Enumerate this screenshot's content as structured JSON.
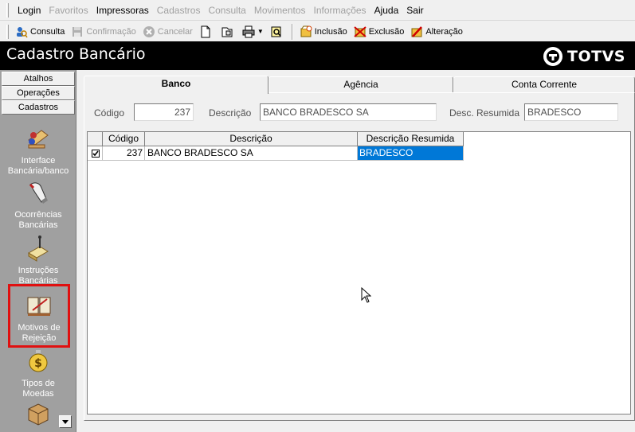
{
  "menu": {
    "items": [
      {
        "label": "Login",
        "enabled": true
      },
      {
        "label": "Favoritos",
        "enabled": false
      },
      {
        "label": "Impressoras",
        "enabled": true
      },
      {
        "label": "Cadastros",
        "enabled": false
      },
      {
        "label": "Consulta",
        "enabled": false
      },
      {
        "label": "Movimentos",
        "enabled": false
      },
      {
        "label": "Informações",
        "enabled": false
      },
      {
        "label": "Ajuda",
        "enabled": true
      },
      {
        "label": "Sair",
        "enabled": true
      }
    ]
  },
  "toolbar": {
    "consulta": "Consulta",
    "confirmacao": "Confirmação",
    "cancelar": "Cancelar",
    "inclusao": "Inclusão",
    "exclusao": "Exclusão",
    "alteracao": "Alteração"
  },
  "window": {
    "title": "Cadastro Bancário",
    "brand": "TOTVS"
  },
  "sidebar": {
    "sections": [
      "Atalhos",
      "Operações",
      "Cadastros"
    ],
    "items": [
      {
        "label_line1": "Interface",
        "label_line2": "Bancária/banco",
        "icon": "bank-interface-icon"
      },
      {
        "label_line1": "Ocorrências",
        "label_line2": "Bancárias",
        "icon": "occurrences-icon"
      },
      {
        "label_line1": "Instruções",
        "label_line2": "Bancárias",
        "icon": "instructions-icon"
      },
      {
        "label_line1": "Motivos de",
        "label_line2": "Rejeição",
        "icon": "rejection-reasons-icon",
        "selected": true
      },
      {
        "label_line1": "Tipos de",
        "label_line2": "Moedas",
        "icon": "currency-types-icon"
      }
    ]
  },
  "tabs": {
    "banco": "Banco",
    "agencia": "Agência",
    "conta": "Conta Corrente"
  },
  "form": {
    "codigo_label": "Código",
    "codigo_value": "237",
    "descricao_label": "Descrição",
    "descricao_value": "BANCO BRADESCO SA",
    "resumida_label": "Desc. Resumida",
    "resumida_value": "BRADESCO"
  },
  "grid": {
    "headers": {
      "codigo": "Código",
      "descricao": "Descrição",
      "resumida": "Descrição Resumida"
    },
    "rows": [
      {
        "checked": true,
        "codigo": "237",
        "descricao": "BANCO BRADESCO SA",
        "resumida": "BRADESCO"
      }
    ]
  },
  "colors": {
    "titlebar_bg": "#000000",
    "sidebar_bg": "#a0a0a0",
    "selection": "#0078d7",
    "highlight_border": "#e01010"
  }
}
